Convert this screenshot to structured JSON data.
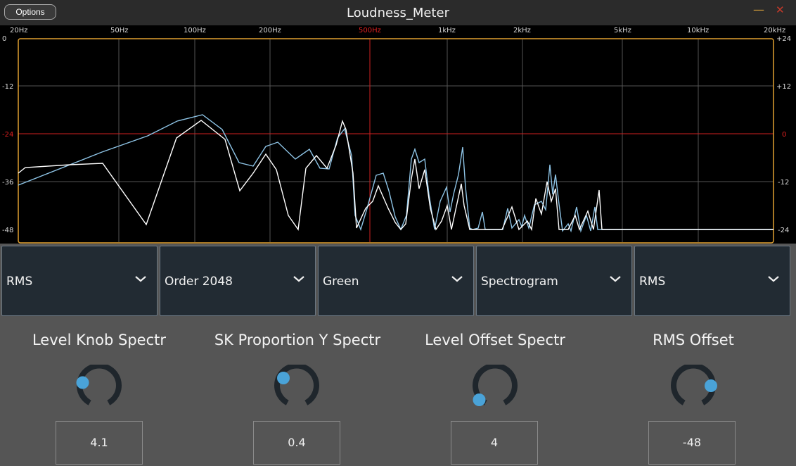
{
  "window": {
    "title": "Loudness_Meter",
    "options_label": "Options",
    "minimize_glyph": "—",
    "close_glyph": "✕"
  },
  "analyzer": {
    "freq_labels": [
      "20Hz",
      "50Hz",
      "100Hz",
      "200Hz",
      "500Hz",
      "1kHz",
      "2kHz",
      "5kHz",
      "10kHz",
      "20kHz"
    ],
    "highlight_freq": "500Hz",
    "left_axis": [
      "0",
      "-12",
      "-24",
      "-36",
      "-48"
    ],
    "right_axis": [
      "+24",
      "+12",
      "0",
      "-12",
      "-24"
    ],
    "colors": {
      "grid": "#555555",
      "highlight": "#d02020",
      "frame": "#e0a030",
      "trace_blue": "#8ec4e6",
      "trace_white": "#ffffff"
    }
  },
  "dropdowns": [
    {
      "label": "RMS"
    },
    {
      "label": "Order 2048"
    },
    {
      "label": "Green"
    },
    {
      "label": "Spectrogram"
    },
    {
      "label": "RMS"
    }
  ],
  "knobs": [
    {
      "label": "Level Knob Spectr",
      "value": "4.1"
    },
    {
      "label": "SK Proportion Y Spectr",
      "value": "0.4"
    },
    {
      "label": "Level Offset Spectr",
      "value": "4"
    },
    {
      "label": "RMS Offset",
      "value": "-48"
    }
  ],
  "colors": {
    "accent": "#4aa3d8",
    "knob_track": "#1f262c",
    "panel": "#555555",
    "dropdown_bg": "#222b33"
  }
}
